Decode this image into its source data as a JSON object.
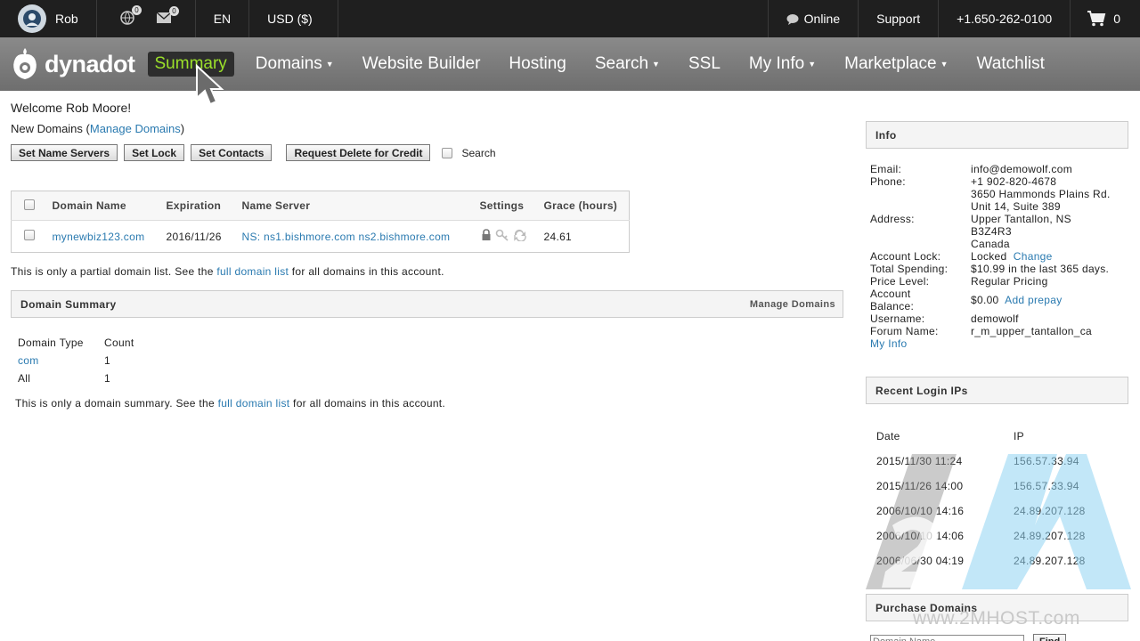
{
  "topbar": {
    "user_name": "Rob",
    "notifications_count": "0",
    "messages_count": "0",
    "language": "EN",
    "currency": "USD ($)",
    "online": "Online",
    "support": "Support",
    "phone": "+1.650-262-0100",
    "cart_count": "0"
  },
  "nav": {
    "logo": "dynadot",
    "items": [
      {
        "label": "Summary"
      },
      {
        "label": "Domains"
      },
      {
        "label": "Website Builder"
      },
      {
        "label": "Hosting"
      },
      {
        "label": "Search"
      },
      {
        "label": "SSL"
      },
      {
        "label": "My Info"
      },
      {
        "label": "Marketplace"
      },
      {
        "label": "Watchlist"
      }
    ],
    "active_color": "#9be02a"
  },
  "main": {
    "welcome": "Welcome Rob Moore!",
    "new_domains_label": "New Domains (",
    "manage_domains_link": "Manage Domains",
    "new_domains_close": ")",
    "buttons": {
      "set_name_servers": "Set Name Servers",
      "set_lock": "Set Lock",
      "set_contacts": "Set Contacts",
      "request_delete": "Request Delete for Credit"
    },
    "search_label": "Search",
    "table": {
      "headers": [
        "Domain Name",
        "Expiration",
        "Name Server",
        "Settings",
        "Grace (hours)"
      ],
      "rows": [
        {
          "domain": "mynewbiz123.com",
          "expiration": "2016/11/26",
          "name_server": "NS: ns1.bishmore.com ns2.bishmore.com",
          "grace": "24.61"
        }
      ]
    },
    "partial_note_pre": "This is only a partial domain list. See the ",
    "full_domain_list": "full domain list",
    "partial_note_post": " for all domains in this account.",
    "summary": {
      "title": "Domain Summary",
      "manage_link": "Manage Domains",
      "headers": [
        "Domain Type",
        "Count"
      ],
      "rows": [
        {
          "type": "com",
          "count": "1"
        },
        {
          "type": "All",
          "count": "1"
        }
      ],
      "note_pre": "This is only a domain summary. See the ",
      "note_link": "full domain list",
      "note_post": " for all domains in this account."
    }
  },
  "info": {
    "title": "Info",
    "email_label": "Email:",
    "email": "info@demowolf.com",
    "phone_label": "Phone:",
    "phone": "+1 902-820-4678",
    "address_label": "Address:",
    "address": [
      "3650 Hammonds Plains Rd.",
      "Unit 14, Suite 389",
      "Upper Tantallon, NS",
      "B3Z4R3",
      "Canada"
    ],
    "lock_label": "Account Lock:",
    "lock_value": "Locked",
    "lock_change": "Change",
    "spending_label": "Total Spending:",
    "spending": "$10.99 in the last 365 days.",
    "price_label": "Price Level:",
    "price": "Regular Pricing",
    "balance_label_1": "Account",
    "balance_label_2": "Balance:",
    "balance": "$0.00",
    "add_prepay": "Add prepay",
    "username_label": "Username:",
    "username": "demowolf",
    "forum_label": "Forum Name:",
    "forum": "r_m_upper_tantallon_ca",
    "my_info_link": "My Info"
  },
  "logins": {
    "title": "Recent Login IPs",
    "headers": [
      "Date",
      "IP"
    ],
    "rows": [
      {
        "date": "2015/11/30 11:24",
        "ip": "156.57.33.94"
      },
      {
        "date": "2015/11/26 14:00",
        "ip": "156.57.33.94"
      },
      {
        "date": "2006/10/10 14:16",
        "ip": "24.89.207.128"
      },
      {
        "date": "2006/10/10 14:06",
        "ip": "24.89.207.128"
      },
      {
        "date": "2006/06/30 04:19",
        "ip": "24.89.207.128"
      }
    ]
  },
  "purchase": {
    "title": "Purchase Domains",
    "input_placeholder": "Domain Name",
    "find": "Find"
  },
  "watermark": {
    "url": "www.2MHOST.com"
  }
}
